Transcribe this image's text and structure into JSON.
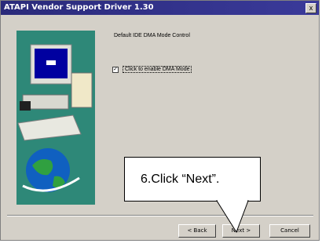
{
  "window": {
    "title": "ATAPI Vendor Support Driver 1.30",
    "close_glyph": "x"
  },
  "main": {
    "label": "Default IDE DMA Mode Control",
    "checkbox_checked": true,
    "checkbox_mark": "✓",
    "checkbox_label": "Click to enable DMA Mode"
  },
  "buttons": {
    "back": "< Back",
    "next": "Next >",
    "cancel": "Cancel"
  },
  "callout": {
    "text": "6.Click “Next”."
  },
  "colors": {
    "titlebar": "#2a2a7a",
    "panel": "#2e8878",
    "window": "#d4d0c8"
  },
  "icons": [
    "computer-icon",
    "globe-icon",
    "keyboard-icon"
  ]
}
